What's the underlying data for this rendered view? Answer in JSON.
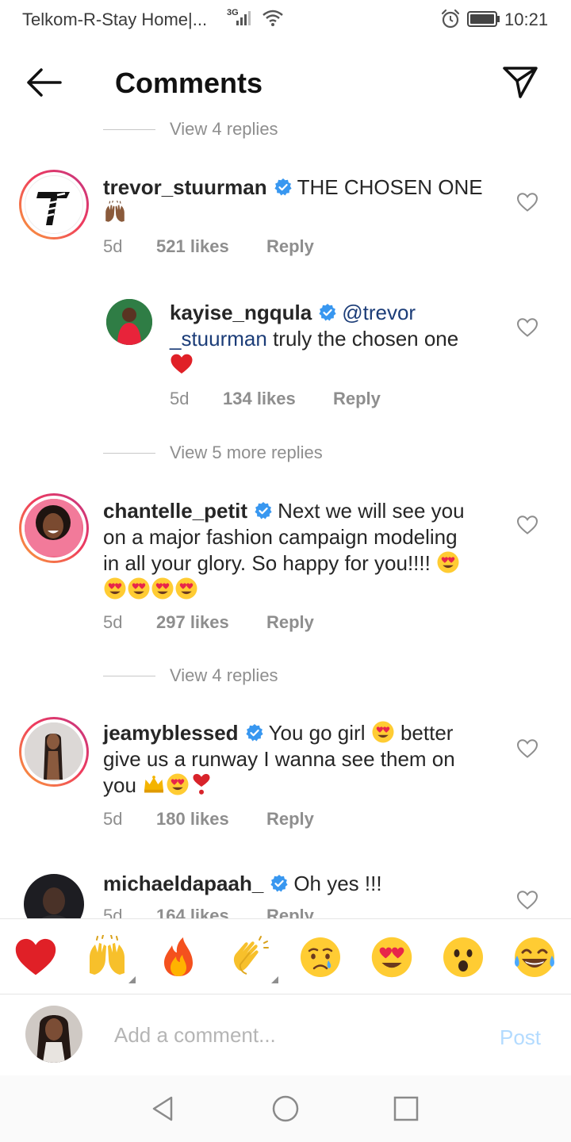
{
  "status_bar": {
    "carrier": "Telkom-R-Stay Home|...",
    "network": "3G",
    "time": "10:21"
  },
  "header": {
    "title": "Comments"
  },
  "comments": [
    {
      "type": "view_replies",
      "label": "View 4 replies"
    },
    {
      "type": "comment",
      "username": "trevor_stuurman",
      "verified": true,
      "text": "THE CHOSEN ONE",
      "emoji": [
        "raising-hands-dark"
      ],
      "age": "5d",
      "likes": "521 likes",
      "reply": "Reply"
    },
    {
      "type": "reply",
      "username": "kayise_ngqula",
      "verified": true,
      "mention_part1": "@trevor",
      "mention_part2": "_stuurman",
      "text": "truly the chosen one",
      "emoji": [
        "red-heart"
      ],
      "age": "5d",
      "likes": "134 likes",
      "reply": "Reply"
    },
    {
      "type": "view_replies",
      "label": "View 5 more replies"
    },
    {
      "type": "comment",
      "username": "chantelle_petit",
      "verified": true,
      "text_line1": "Next we will see you",
      "text_line2": "on a major fashion campaign modeling",
      "text_line3": "in all your glory. So happy for you!!!!",
      "emoji": [
        "heart-eyes",
        "heart-eyes",
        "heart-eyes",
        "heart-eyes",
        "heart-eyes"
      ],
      "age": "5d",
      "likes": "297 likes",
      "reply": "Reply"
    },
    {
      "type": "view_replies",
      "label": "View 4 replies"
    },
    {
      "type": "comment",
      "username": "jeamyblessed",
      "verified": true,
      "text_line1a": "You go girl",
      "text_line1b": "better",
      "text_line2": "give us a runway I wanna see them on",
      "text_line3": "you",
      "emoji": [
        "heart-eyes",
        "crown",
        "heart-eyes",
        "heart-exclamation"
      ],
      "age": "5d",
      "likes": "180 likes",
      "reply": "Reply"
    },
    {
      "type": "comment",
      "username": "michaeldapaah_",
      "verified": true,
      "text": "Oh yes !!!",
      "age": "5d",
      "likes": "164 likes",
      "reply": "Reply"
    }
  ],
  "emoji_bar": [
    "red-heart",
    "raising-hands",
    "fire",
    "clapping-hands",
    "crying-face",
    "heart-eyes",
    "surprised-face",
    "tears-of-joy"
  ],
  "composer": {
    "placeholder": "Add a comment...",
    "post_label": "Post"
  },
  "colors": {
    "verified": "#3897f0",
    "link": "#1c3d78",
    "meta": "#8e8e8e",
    "post_disabled": "#b3dbff"
  }
}
